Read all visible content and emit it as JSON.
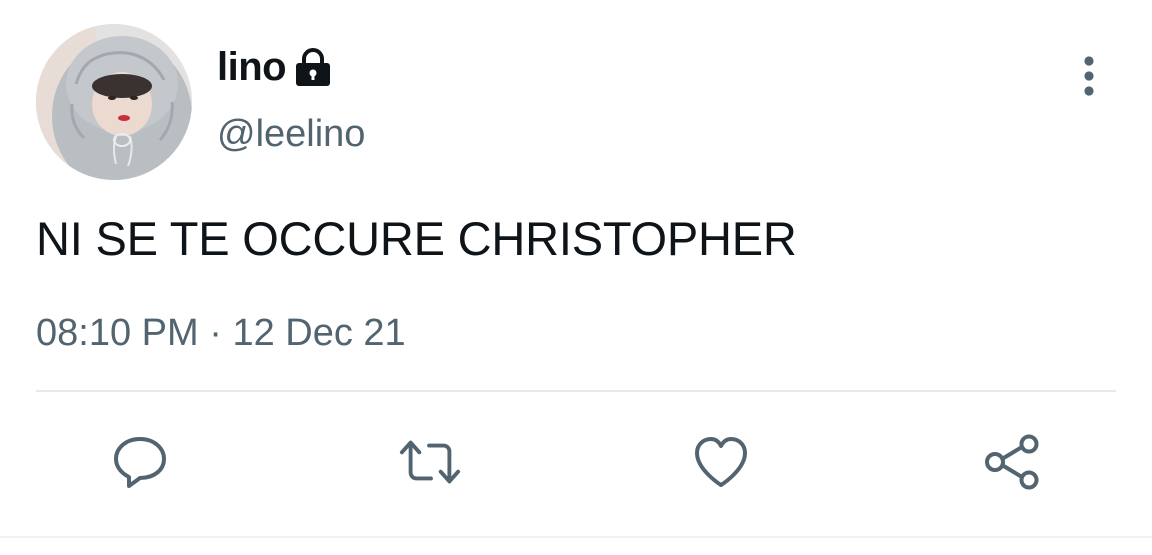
{
  "tweet": {
    "display_name": "lino",
    "handle": "@leelino",
    "protected": true,
    "text": "NI SE TE OCCURE CHRISTOPHER",
    "time": "08:10 PM",
    "separator": "·",
    "date": "12 Dec 21"
  },
  "icons": {
    "lock": "lock-icon",
    "more": "more-vertical-icon",
    "reply": "reply-icon",
    "retweet": "retweet-icon",
    "like": "heart-icon",
    "share": "share-icon"
  },
  "colors": {
    "primary_text": "#0f1419",
    "secondary_text": "#536471",
    "icon": "#536471",
    "divider": "#e6e9eb"
  }
}
